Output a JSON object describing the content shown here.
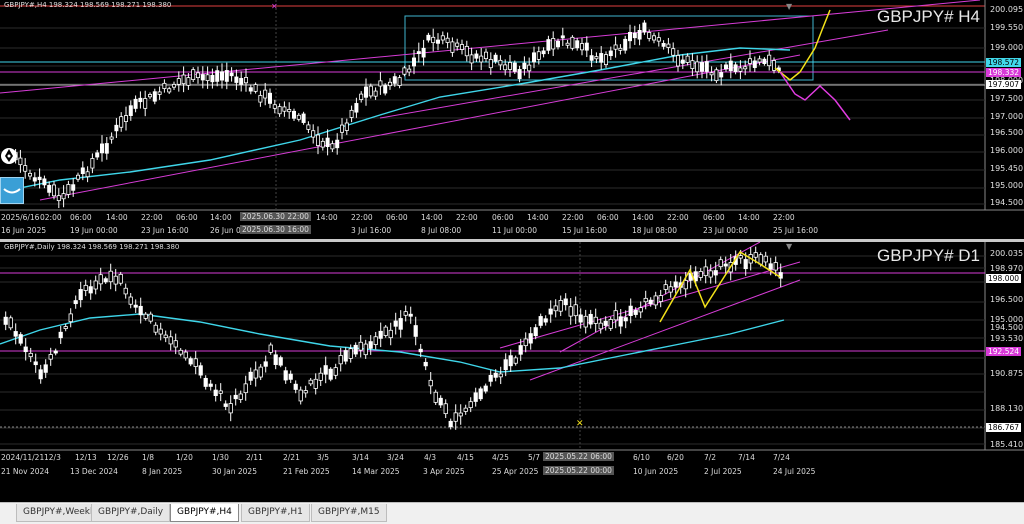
{
  "top": {
    "header": "GBPJPY#,H4  198.324 198.569 198.271 198.380",
    "title": "GBPJPY# H4",
    "price_ticks": [
      "200.095",
      "199.550",
      "199.000",
      "198.500",
      "198.000",
      "197.500",
      "197.000",
      "196.500",
      "196.000",
      "195.450",
      "195.000",
      "194.500"
    ],
    "box_ask": "198.572",
    "box_alert": "198.332",
    "box_low": "197.907",
    "time_row1": [
      "2025/6/16",
      "02:00",
      "06:00",
      "14:00",
      "22:00",
      "06:00",
      "14:00",
      "2025.06.30 22:00",
      "14:00",
      "22:00",
      "06:00",
      "14:00",
      "22:00",
      "06:00",
      "14:00",
      "22:00",
      "06:00",
      "14:00",
      "22:00",
      "06:00",
      "14:00",
      "22:00"
    ],
    "time_row2": [
      "16 Jun 2025",
      "19 Jun 00:00",
      "23 Jun 16:00",
      "26 Jun 0",
      "2025.06.30 16:00",
      "3 Jul 16:00",
      "8 Jul 08:00",
      "11 Jul 00:00",
      "15 Jul 16:00",
      "18 Jul 08:00",
      "23 Jul 00:00",
      "25 Jul 16:00"
    ]
  },
  "bottom": {
    "header": "GBPJPY#,Daily  198.324 198.569 198.271 198.380",
    "title": "GBPJPY# D1",
    "price_ticks": [
      "200.035",
      "198.970",
      "198.000",
      "196.500",
      "195.000",
      "194.500",
      "193.530",
      "190.875",
      "188.130",
      "185.410"
    ],
    "box_magenta": "192.524",
    "box_white": "186.767",
    "time_row1": [
      "2024/11/21",
      "12/3",
      "12/13",
      "12/26",
      "1/8",
      "1/20",
      "1/30",
      "2/11",
      "2/21",
      "3/5",
      "3/14",
      "3/24",
      "4/3",
      "4/15",
      "4/25",
      "5/7",
      "2025.05.22 06:00",
      "6/10",
      "6/20",
      "7/2",
      "7/14",
      "7/24"
    ],
    "time_row2": [
      "21 Nov 2024",
      "13 Dec 2024",
      "8 Jan 2025",
      "30 Jan 2025",
      "21 Feb 2025",
      "14 Mar 2025",
      "3 Apr 2025",
      "25 Apr 2025",
      "2025.05.22 00:00",
      "10 Jun 2025",
      "2 Jul 2025",
      "24 Jul 2025"
    ]
  },
  "tabs": [
    "GBPJPY#,Weekly",
    "GBPJPY#,Daily",
    "GBPJPY#,H4",
    "GBPJPY#,H1",
    "GBPJPY#,M15"
  ],
  "active_tab": "GBPJPY#,H4",
  "colors": {
    "candle": "#ffffff",
    "ma": "#3fd6ea",
    "channel": "#d63cd6",
    "forecast_up": "#f3e21a",
    "forecast_down": "#e13ce1",
    "grid": "#1e1e1e"
  }
}
